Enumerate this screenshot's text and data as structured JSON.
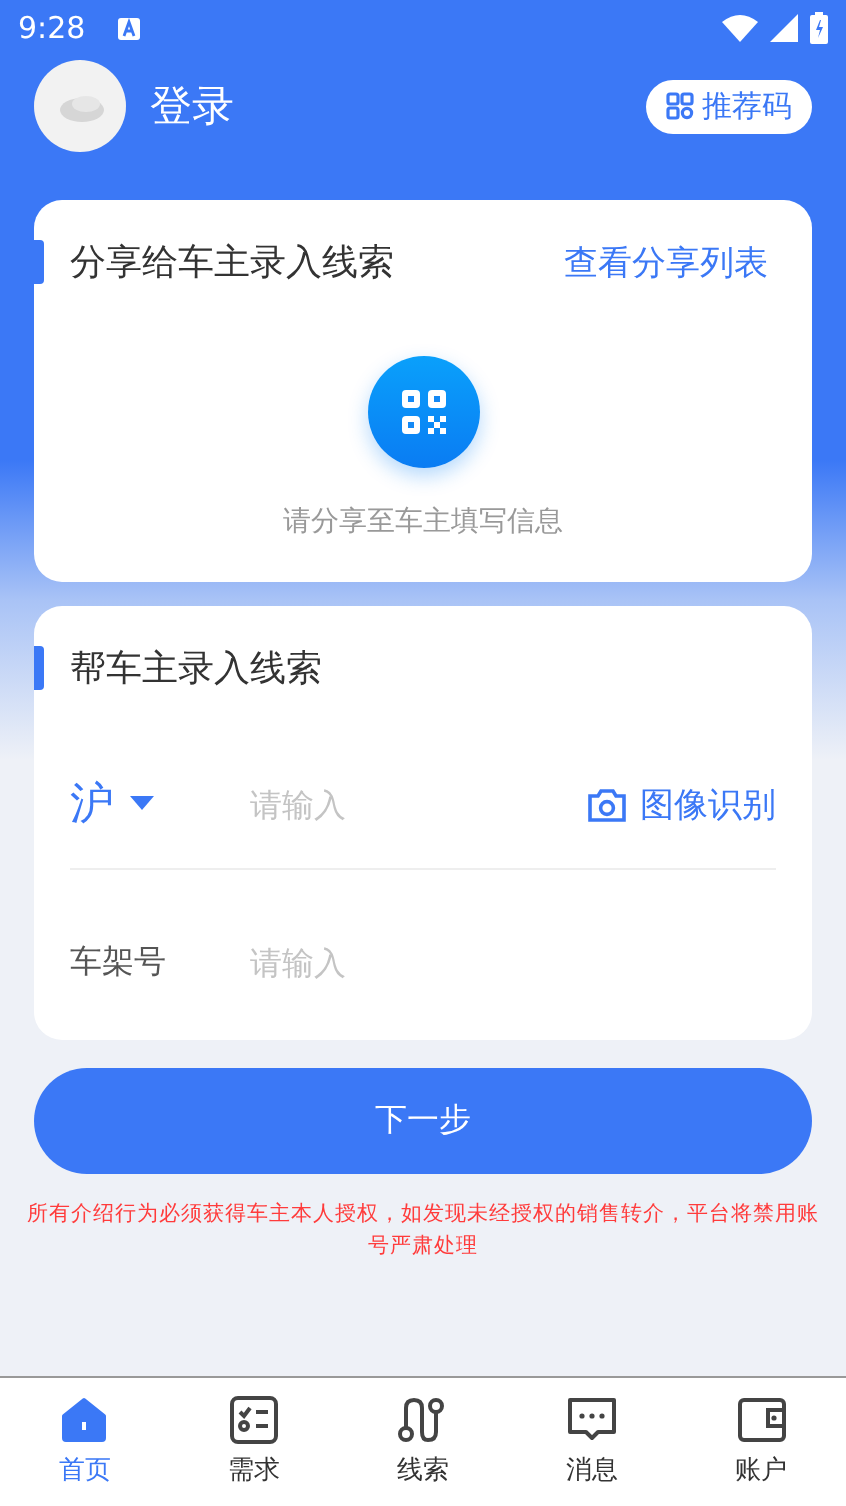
{
  "status_bar": {
    "time": "9:28"
  },
  "header": {
    "title": "登录",
    "referral_button": "推荐码"
  },
  "share_card": {
    "title": "分享给车主录入线索",
    "link": "查看分享列表",
    "hint": "请分享至车主填写信息"
  },
  "entry_card": {
    "title": "帮车主录入线索",
    "plate_prefix": "沪",
    "plate_placeholder": "请输入",
    "ocr_button": "图像识别",
    "vin_label": "车架号",
    "vin_placeholder": "请输入"
  },
  "next_button": "下一步",
  "notice": "所有介绍行为必须获得车主本人授权，如发现未经授权的销售转介，平台将禁用账号严肃处理",
  "tab_bar": [
    {
      "label": "首页",
      "selected": true
    },
    {
      "label": "需求",
      "selected": false
    },
    {
      "label": "线索",
      "selected": false
    },
    {
      "label": "消息",
      "selected": false
    },
    {
      "label": "账户",
      "selected": false
    }
  ]
}
